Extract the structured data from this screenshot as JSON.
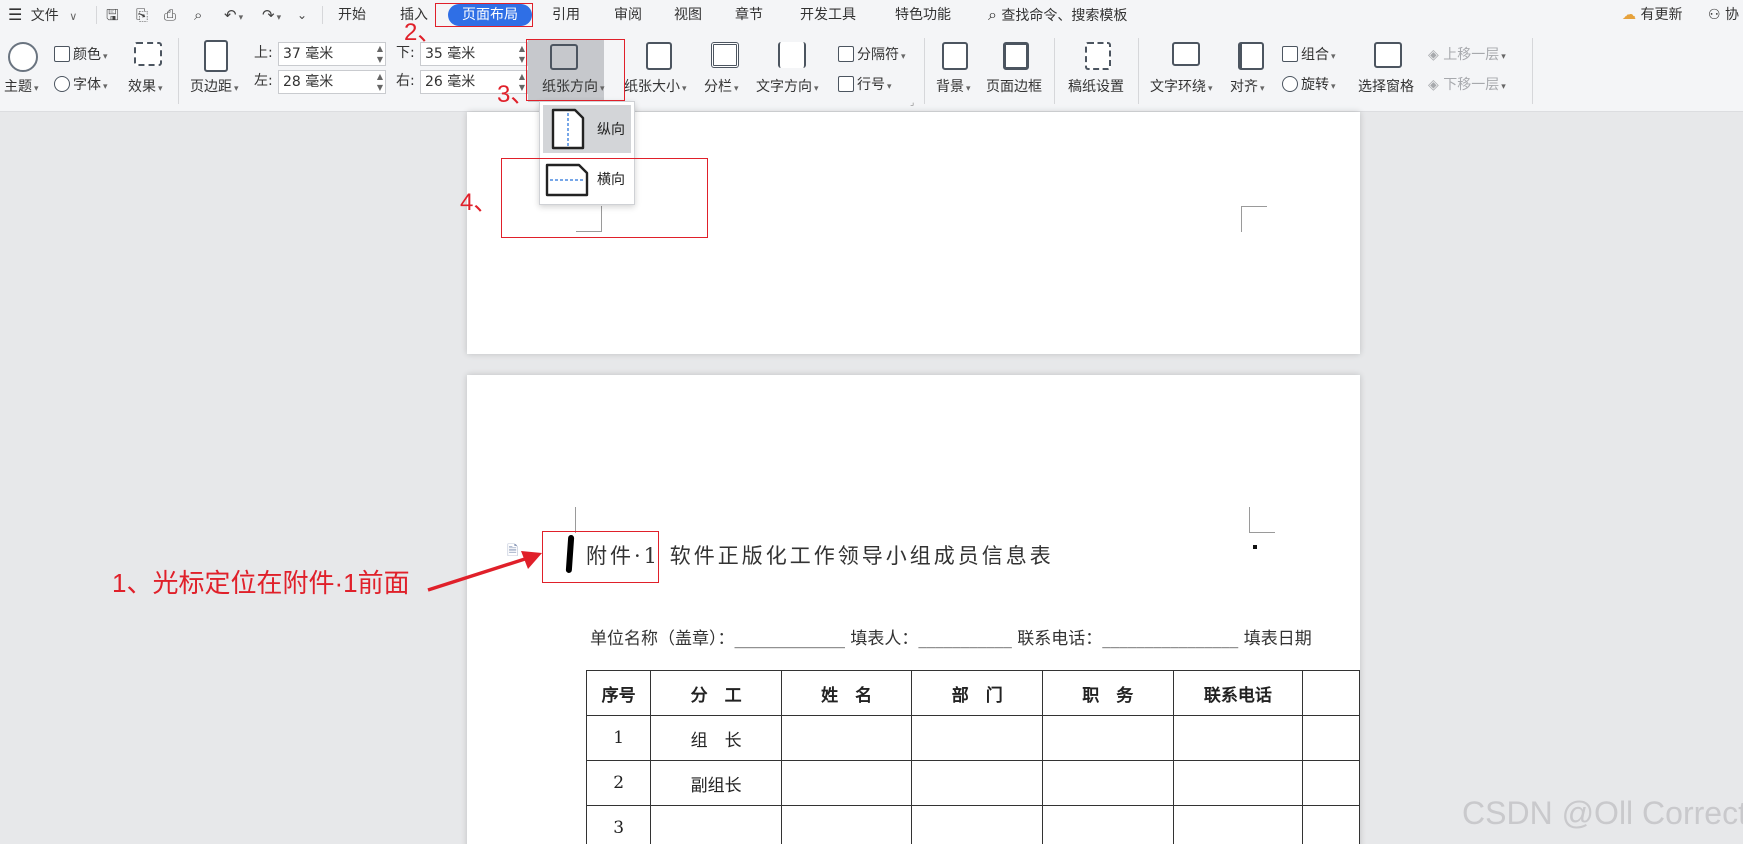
{
  "menubar": {
    "file_label": "文件",
    "tabs": [
      "开始",
      "插入",
      "页面布局",
      "引用",
      "审阅",
      "视图",
      "章节",
      "开发工具",
      "特色功能"
    ],
    "active_tab": "页面布局",
    "search_label": "查找命令、搜索模板",
    "update_label": "有更新",
    "collab_label": "协"
  },
  "ribbon": {
    "theme_label": "主题",
    "color_label": "颜色",
    "font_label": "字体",
    "effect_label": "效果",
    "margin_label": "页边距",
    "margins": {
      "top_label": "上:",
      "top_value": "37 毫米",
      "bottom_label": "下:",
      "bottom_value": "35 毫米",
      "left_label": "左:",
      "left_value": "28 毫米",
      "right_label": "右:",
      "right_value": "26 毫米"
    },
    "orientation_label": "纸张方向",
    "size_label": "纸张大小",
    "columns_label": "分栏",
    "text_direction_label": "文字方向",
    "separator_label": "分隔符",
    "line_number_label": "行号",
    "background_label": "背景",
    "page_border_label": "页面边框",
    "manuscript_label": "稿纸设置",
    "text_wrap_label": "文字环绕",
    "align_label": "对齐",
    "group_label": "组合",
    "rotate_label": "旋转",
    "selection_pane_label": "选择窗格",
    "bring_forward_label": "上移一层",
    "send_backward_label": "下移一层"
  },
  "orientation_dropdown": {
    "portrait_label": "纵向",
    "landscape_label": "横向"
  },
  "annotations": {
    "step1": "1、光标定位在附件·1前面",
    "step2": "2、",
    "step3": "3、",
    "step4": "4、"
  },
  "document": {
    "title": "附件·1 软件正版化工作领导小组成员信息表",
    "info_line": "单位名称（盖章）：_____________ 填表人：___________ 联系电话：________________ 填表日期",
    "table": {
      "headers": [
        "序号",
        "分　工",
        "姓　名",
        "部　门",
        "职　务",
        "联系电话"
      ],
      "rows": [
        [
          "1",
          "组　长",
          "",
          "",
          "",
          ""
        ],
        [
          "2",
          "副组长",
          "",
          "",
          "",
          ""
        ],
        [
          "3",
          "",
          "",
          "",
          "",
          ""
        ]
      ]
    }
  },
  "watermark": "CSDN @Oll Correct",
  "colors": {
    "accent": "#2f6fe6",
    "annotation": "#e0202a"
  }
}
